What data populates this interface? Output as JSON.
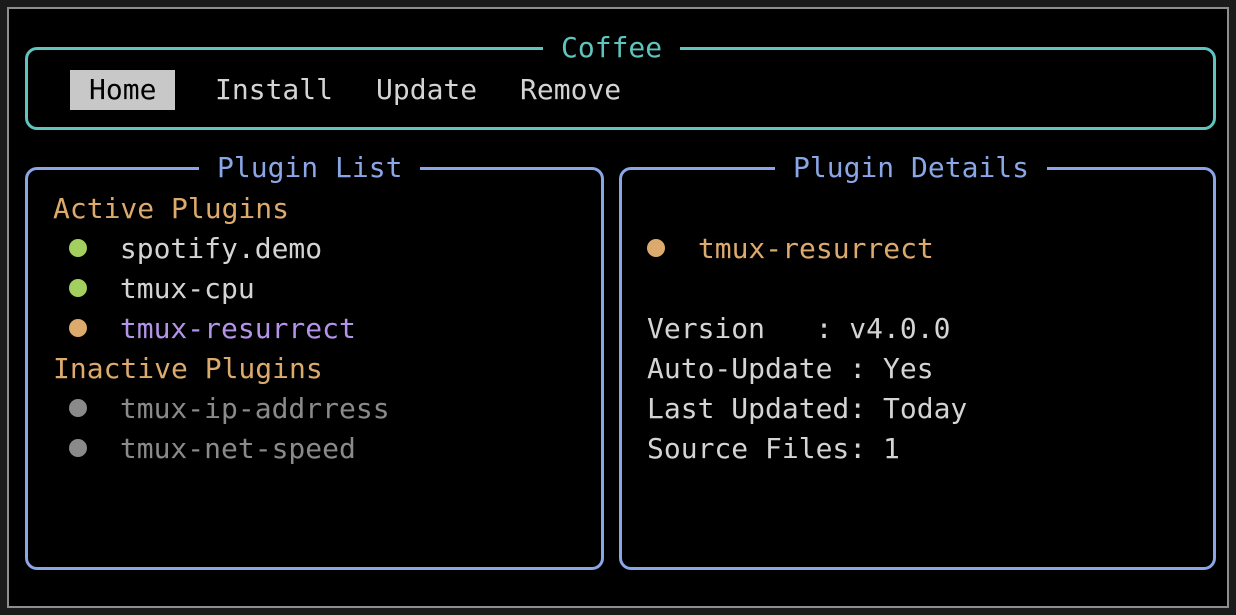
{
  "app": {
    "title": "Coffee"
  },
  "tabs": [
    {
      "label": "Home",
      "active": true
    },
    {
      "label": "Install",
      "active": false
    },
    {
      "label": "Update",
      "active": false
    },
    {
      "label": "Remove",
      "active": false
    }
  ],
  "plugin_list": {
    "title": "Plugin List",
    "active_header": "Active Plugins",
    "inactive_header": "Inactive Plugins",
    "active": [
      {
        "name": "spotify.demo",
        "dot_color": "#a3cf5e",
        "text_color": "#d4d4d4"
      },
      {
        "name": "tmux-cpu",
        "dot_color": "#a3cf5e",
        "text_color": "#d4d4d4"
      },
      {
        "name": "tmux-resurrect",
        "dot_color": "#dcaa6c",
        "text_color": "#b394e8"
      }
    ],
    "inactive": [
      {
        "name": "tmux-ip-addrress",
        "dot_color": "#8a8a8a",
        "text_color": "#8a8a8a"
      },
      {
        "name": "tmux-net-speed",
        "dot_color": "#8a8a8a",
        "text_color": "#8a8a8a"
      }
    ]
  },
  "plugin_details": {
    "title": "Plugin Details",
    "name": "tmux-resurrect",
    "dot_color": "#dcaa6c",
    "rows": [
      "Version   : v4.0.0",
      "Auto-Update : Yes",
      "Last Updated: Today",
      "Source Files: 1"
    ]
  },
  "colors": {
    "tabs_border": "#5ec4bd",
    "panel_border": "#8aa6e6",
    "section_header": "#dcaa6c"
  }
}
